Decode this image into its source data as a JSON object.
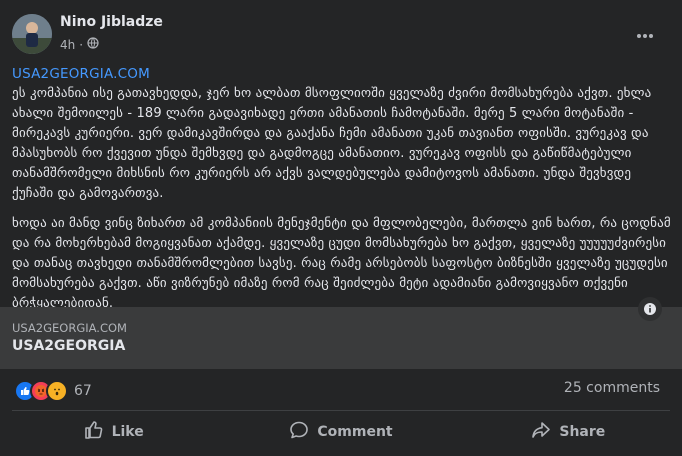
{
  "post": {
    "author": "Nino Jibladze",
    "time": "4h",
    "audience_icon": "globe-icon",
    "link_text": "USA2GEORGIA.COM",
    "paragraph1": "ეს კომპანია ისე გათავხედდა, ჯერ ხო ალბათ მსოფლიოში ყველაზე ძვირი მომსახურება აქვთ. ეხლა ახალი შემოილეს - 189 ლარი გადავიხადე ერთი ამანათის ჩამოტანაში. მერე 5 ლარი მოტანაში - მირეკავს კურიერი. ვერ დამიკავშირდა და გააქანა ჩემი ამანათი უკან თავიანთ ოფისში. ვურეკავ და მპასუხობს რო ქვევით უნდა შემხვდე და გადმოგცე ამანათიო. ვურეკავ ოფისს და გაწიწმატებული თანამშრომელი მიხსნის რო კურიერს არ აქვს ვალდებულება დამიტოვოს ამანათი. უნდა შევხვდე ქუჩაში და გამოვართვა.",
    "paragraph2": "ხოდა აი მანდ ვინც ზიხართ ამ კომპანიის მენეჯმენტი და მფლობელები, მართლა ვინ ხართ, რა ცოდნამ და რა მოხერხებამ მოგიყვანათ აქამდე. ყველაზე ცუდი მომსახურება ხო გაქვთ, ყველაზე უუუუუძვირესი და თანაც თავხედი თანამშრომლებით სავსე. რაც რამე არსებობს საფოსტო ბიზნესში ყველაზე უცუდესი მომსახურება გაქვთ. აწი ვიზრუნებ იმაზე რომ რაც შეიძლება მეტი ადამიანი გამოვიყვანო თქვენი ბრჭყალებიდან."
  },
  "link_preview": {
    "domain": "USA2GEORGIA.COM",
    "title": "USA2GEORGIA"
  },
  "stats": {
    "reaction_count": "67",
    "comments": "25 comments"
  },
  "actions": {
    "like": "Like",
    "comment": "Comment",
    "share": "Share"
  },
  "colors": {
    "background": "#242526",
    "link": "#4599ff",
    "preview_bg": "#3a3b3c",
    "muted": "#b0b3b8"
  }
}
